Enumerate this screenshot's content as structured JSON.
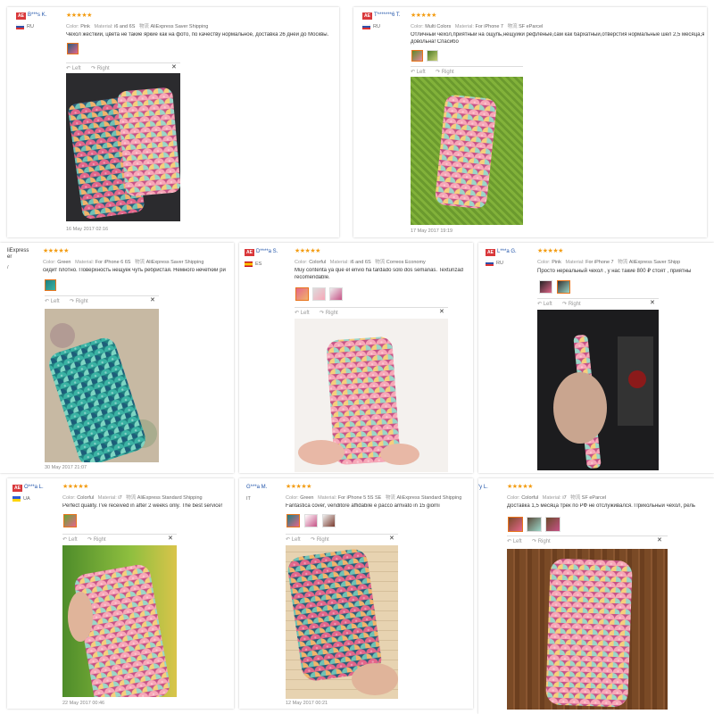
{
  "rotate_left": "Left",
  "rotate_right": "Right",
  "reviews": [
    {
      "badge": "AE",
      "name": "B***s K.",
      "country": "RU",
      "color_label": "Color:",
      "color": "Pink",
      "material_label": "Material:",
      "material": "i6 and 6S",
      "shipping_label": "物流",
      "shipping": "AliExpress Saver Shipping",
      "text": "Чехол жесткий, цвета не такие яркие как на фото, по качеству нормальное, доставка 26 дней до Москвы.",
      "date": "16 May 2017 02:16"
    },
    {
      "badge": "AE",
      "name": "T*******6 T.",
      "country": "RU",
      "color_label": "Color:",
      "color": "Multi Colors",
      "material_label": "Material:",
      "material": "For iPhone 7",
      "shipping_label": "物流",
      "shipping": "SF eParcel",
      "text": "Отличный чехол,приятный на ощупь,нещуйки рефлёные,сам как бархатный,отверстия нормальные шел 2,5 месяца,я",
      "text2": "довольна! Спасибо",
      "date": "17 May 2017 19:19"
    },
    {
      "name": "liExpress",
      "name2": "er",
      "country": "/",
      "color_label": "Color:",
      "color": "Green",
      "material_label": "Material:",
      "material": "For iPhone 6 6S",
      "shipping_label": "物流",
      "shipping": "AliExpress Saver Shipping",
      "text": "сидит плотно. Поверхность нещуек чуть ребристая. Немного нечеткий ри",
      "date": "30 May 2017 21:07"
    },
    {
      "badge": "AE",
      "name": "D****a S.",
      "country": "ES",
      "color_label": "Color:",
      "color": "Colorful",
      "material_label": "Material:",
      "material": "i6 and 6S",
      "shipping_label": "物流",
      "shipping": "Correos Economy",
      "text": "Muy contenta ya que el envio ha tardado solo dos semanas. Texturizad",
      "text2": "recomendable."
    },
    {
      "badge": "AE",
      "name": "L***a G.",
      "country": "RU",
      "color_label": "Color:",
      "color": "Pink",
      "material_label": "Material:",
      "material": "For iPhone 7",
      "shipping_label": "物流",
      "shipping": "AliExpress Saver Shipp",
      "text": "Просто нереальный чехол , у нас такие 800 ₽ стоят , приятны"
    },
    {
      "badge": "AE",
      "name": "O***a L.",
      "country": "UA",
      "color_label": "Color:",
      "color": "Colorful",
      "material_label": "Material:",
      "material": "i7",
      "shipping_label": "物流",
      "shipping": "AliExpress Standard Shipping",
      "text": "Perfect quality. I've received in after 2 weeks only. The best service!",
      "date": "22 May 2017 00:46"
    },
    {
      "name": "G***a M.",
      "country": "IT",
      "color_label": "Color:",
      "color": "Green",
      "material_label": "Material:",
      "material": "For iPhone 5 5S SE",
      "shipping_label": "物流",
      "shipping": "AliExpress Standard Shipping",
      "text": "Fantastica cover, venditore affidabile e pacco arrivato in 15 giorni",
      "date": "12 May 2017 00:21"
    },
    {
      "name": "'y L.",
      "color_label": "Color:",
      "color": "Colorful",
      "material_label": "Material:",
      "material": "i7",
      "shipping_label": "物流",
      "shipping": "SF eParcel",
      "text": "Доставка 1,5 месяца трек по РФ не отслуживался. Прикольный чехол, рель"
    }
  ],
  "colors": {
    "star": "#f39c12",
    "badge": "#d9383b",
    "link": "#2255aa",
    "selected_thumb": "#e8741c"
  }
}
